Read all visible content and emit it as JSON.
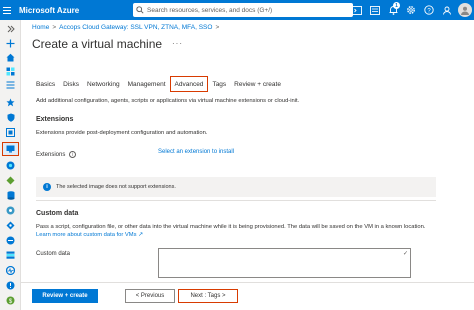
{
  "app": {
    "name": "Microsoft Azure"
  },
  "search": {
    "placeholder": "Search resources, services, and docs (G+/)"
  },
  "top_icons": [
    "terminal-icon",
    "directory-icon",
    "bell-icon",
    "gear-icon",
    "help-icon",
    "feedback-icon"
  ],
  "notifications": {
    "count": "1"
  },
  "breadcrumb": {
    "items": [
      "Home",
      "Accops Cloud Gateway: SSL VPN, ZTNA, MFA, SSO"
    ]
  },
  "page": {
    "title": "Create a virtual machine",
    "more": "···"
  },
  "tabs": [
    {
      "label": "Basics",
      "active": false
    },
    {
      "label": "Disks",
      "active": false
    },
    {
      "label": "Networking",
      "active": false
    },
    {
      "label": "Management",
      "active": false
    },
    {
      "label": "Advanced",
      "active": true
    },
    {
      "label": "Tags",
      "active": false
    },
    {
      "label": "Review + create",
      "active": false
    }
  ],
  "intro": "Add additional configuration, agents, scripts or applications via virtual machine extensions or cloud-init.",
  "extensions": {
    "heading": "Extensions",
    "description": "Extensions provide post-deployment configuration and automation.",
    "label": "Extensions",
    "info": "i",
    "link": "Select an extension to install"
  },
  "banner": {
    "icon": "i",
    "text": "The selected image does not support extensions."
  },
  "custom_data": {
    "heading": "Custom data",
    "description": "Pass a script, configuration file, or other data into the virtual machine while it is being provisioned. The data will be saved on the VM in a known location.",
    "link": "Learn more about custom data for VMs",
    "link_icon": "↗",
    "label": "Custom data",
    "value": "",
    "check": "✓"
  },
  "footer": {
    "review_label": "Review + create",
    "prev_label": "< Previous",
    "next_label": "Next : Tags >"
  },
  "colors": {
    "brand": "#0078d4",
    "highlight": "#d83b01"
  }
}
